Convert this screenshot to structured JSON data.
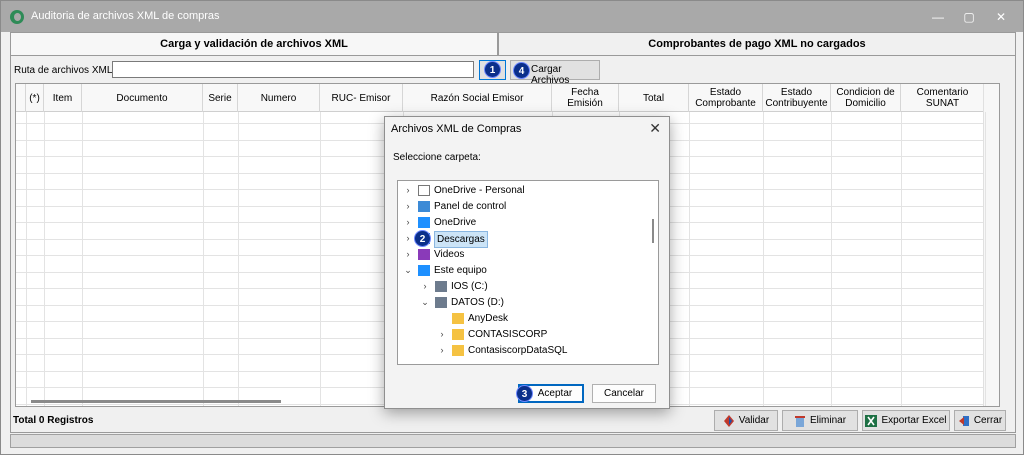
{
  "window": {
    "title": "Auditoria de archivos XML de compras",
    "minimize": "—",
    "maximize": "▢",
    "close": "✕"
  },
  "tabs": [
    {
      "label": "Carga y validación de archivos XML",
      "active": true
    },
    {
      "label": "Comprobantes de pago XML no cargados",
      "active": false
    }
  ],
  "path": {
    "label": "Ruta de archivos XML",
    "value": "",
    "browse_badge": "1",
    "load_badge": "4",
    "load_label": "Cargar Archivos"
  },
  "grid": {
    "columns": [
      "(*)",
      "Item",
      "Documento",
      "Serie",
      "Numero",
      "RUC- Emisor",
      "Razón Social Emisor",
      "Fecha Emisión",
      "Total",
      "Estado Comprobante",
      "Estado Contribuyente",
      "Condicion de Domicilio",
      "Comentario SUNAT"
    ]
  },
  "footer": {
    "status": "Total 0 Registros",
    "buttons": [
      "Validar",
      "Eliminar",
      "Exportar Excel",
      "Cerrar"
    ]
  },
  "dialog": {
    "title": "Archivos XML de Compras",
    "close": "✕",
    "prompt": "Seleccione carpeta:",
    "tree": [
      {
        "label": "OneDrive - Personal",
        "icon": "document-icon",
        "expanded": false
      },
      {
        "label": "Panel de control",
        "icon": "control-panel-icon",
        "expanded": false
      },
      {
        "label": "OneDrive",
        "icon": "cloud-icon",
        "expanded": false
      },
      {
        "label": "Descargas",
        "icon": "download-icon",
        "expanded": false,
        "selected": true,
        "badge": "2"
      },
      {
        "label": "Videos",
        "icon": "video-icon",
        "expanded": false
      },
      {
        "label": "Este equipo",
        "icon": "computer-icon",
        "expanded": true
      },
      {
        "label": "IOS (C:)",
        "icon": "drive-icon",
        "expanded": false
      },
      {
        "label": "DATOS (D:)",
        "icon": "drive-icon",
        "expanded": true
      },
      {
        "label": "AnyDesk",
        "icon": "folder-icon",
        "expanded": null
      },
      {
        "label": "CONTASISCORP",
        "icon": "folder-icon",
        "expanded": false
      },
      {
        "label": "ContasiscorpDataSQL",
        "icon": "folder-icon",
        "expanded": false
      }
    ],
    "accept_badge": "3",
    "accept": "Aceptar",
    "cancel": "Cancelar"
  },
  "colors": {
    "titlebar": "#a9a9a9",
    "badge": "#0b2f8a",
    "accent": "#0067c0",
    "selection": "#cce4f7"
  }
}
